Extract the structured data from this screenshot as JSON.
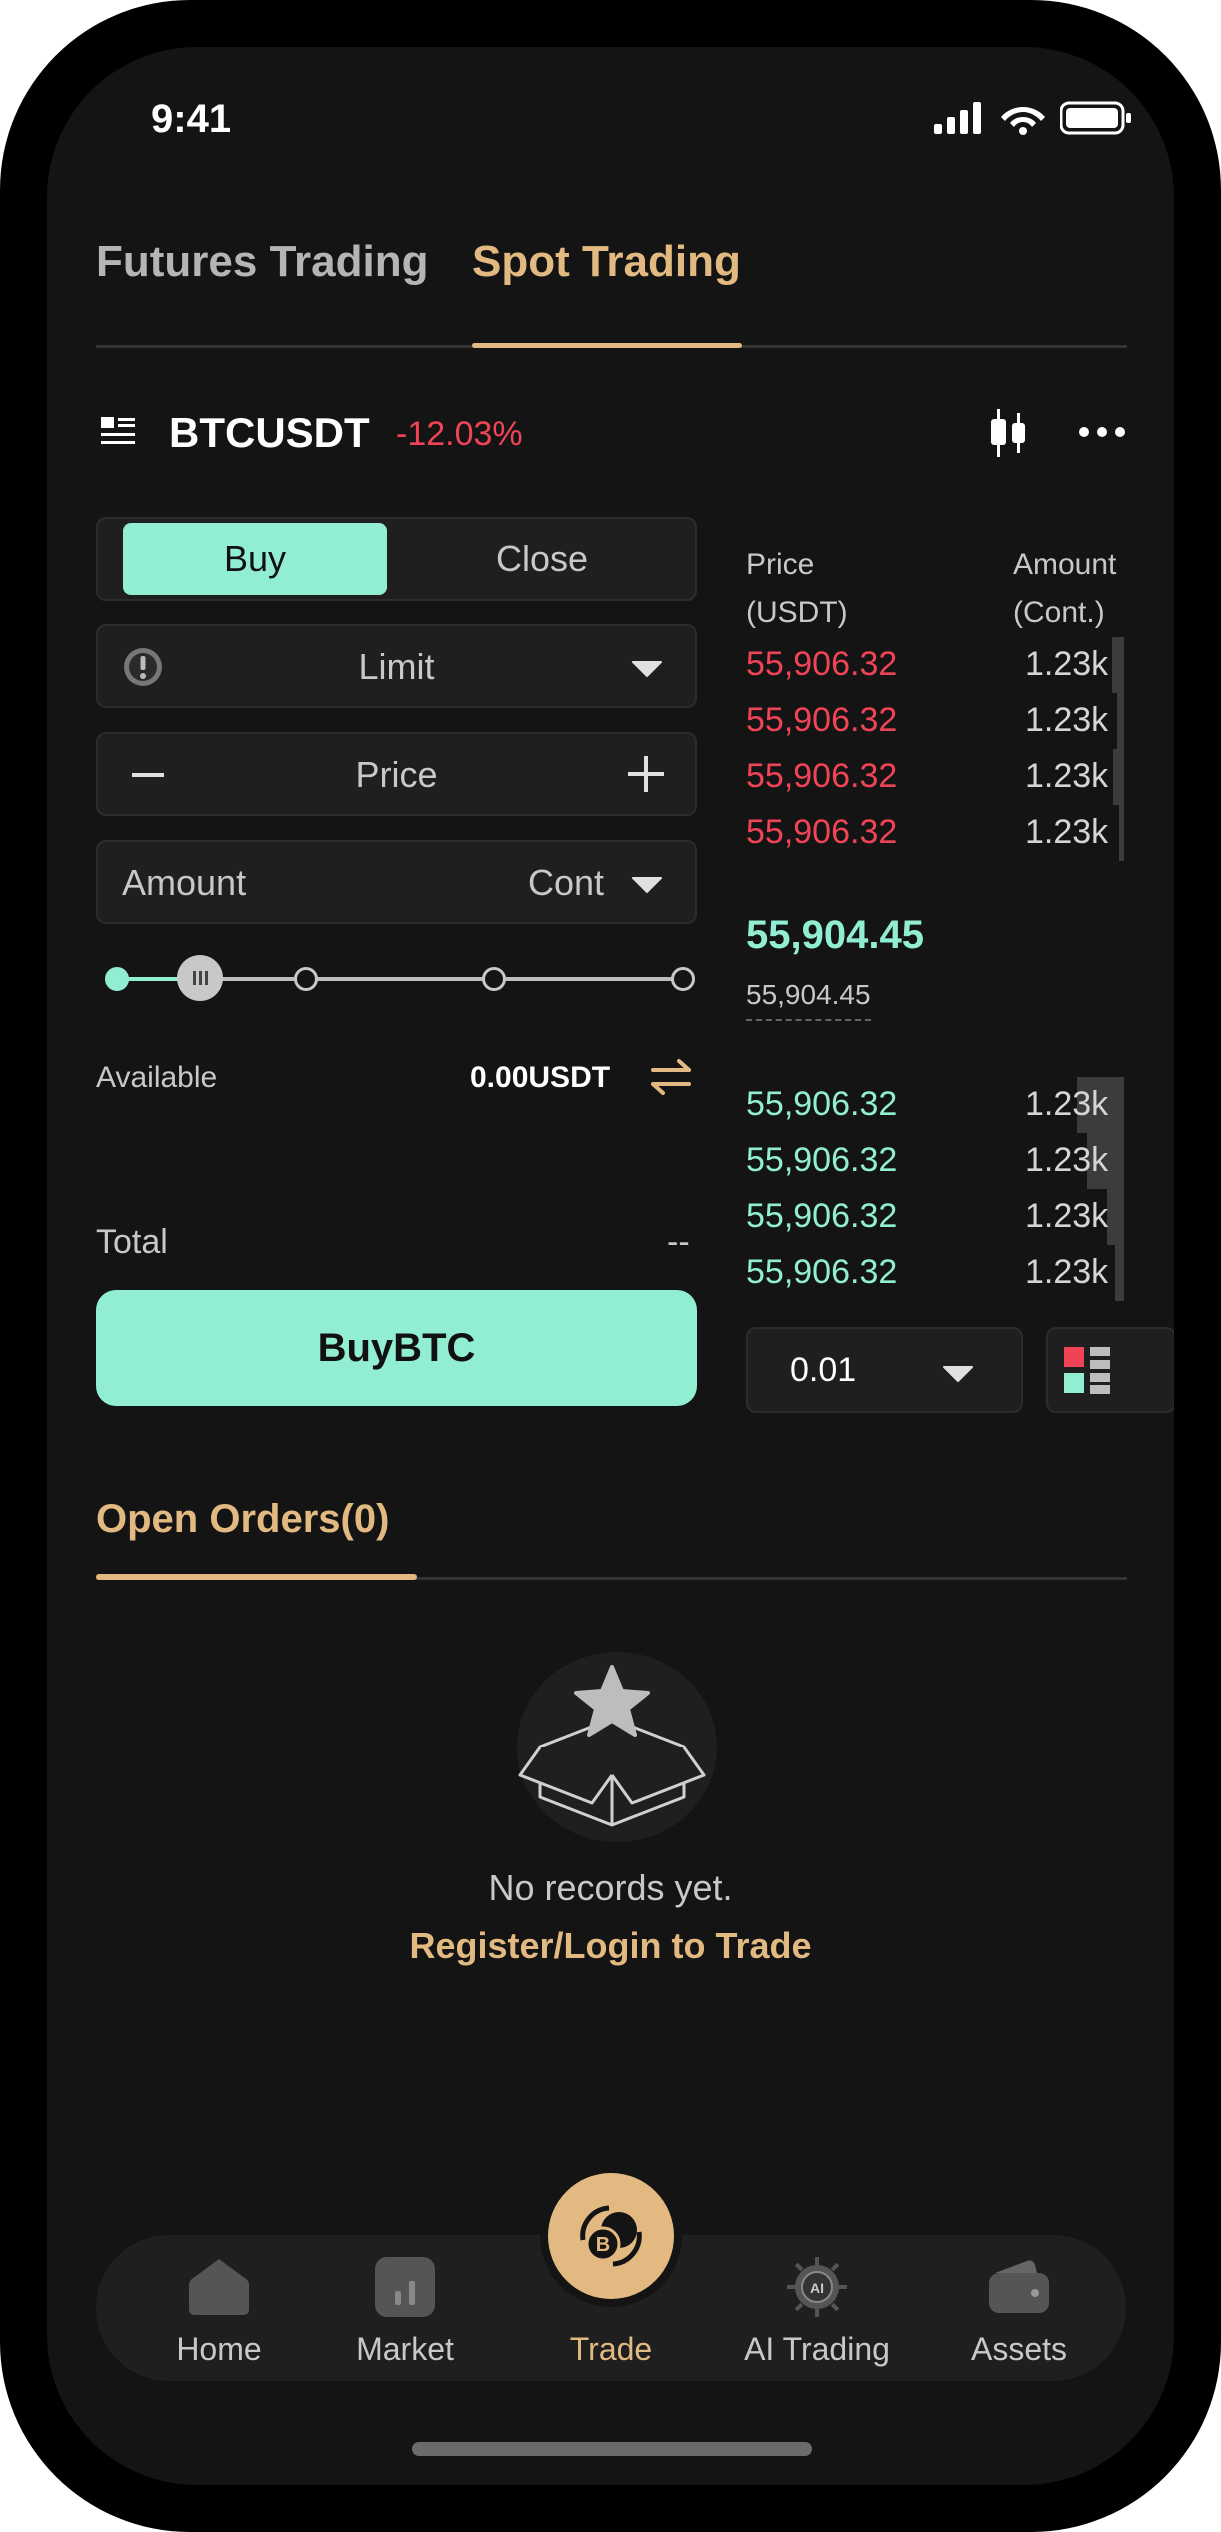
{
  "status_bar": {
    "time": "9:41"
  },
  "tabs": [
    {
      "label": "Futures Trading",
      "active": false
    },
    {
      "label": "Spot Trading",
      "active": true
    }
  ],
  "symbol": {
    "name": "BTCUSDT",
    "change": "-12.03%"
  },
  "order_form": {
    "side_buy": "Buy",
    "side_close": "Close",
    "order_type": "Limit",
    "price_placeholder": "Price",
    "amount_label": "Amount",
    "amount_unit": "Cont",
    "slider_level_fraction": 0.25,
    "available_label": "Available",
    "available_value": "0.00USDT",
    "total_label": "Total",
    "total_value": "--",
    "submit_label": "BuyBTC"
  },
  "orderbook": {
    "price_header": "Price",
    "price_unit": "(USDT)",
    "amount_header": "Amount",
    "amount_unit": "(Cont.)",
    "asks": [
      {
        "price": "55,906.32",
        "amount": "1.23k"
      },
      {
        "price": "55,906.32",
        "amount": "1.23k"
      },
      {
        "price": "55,906.32",
        "amount": "1.23k"
      },
      {
        "price": "55,906.32",
        "amount": "1.23k"
      }
    ],
    "last_price": "55,904.45",
    "mark_price": "55,904.45",
    "bids": [
      {
        "price": "55,906.32",
        "amount": "1.23k"
      },
      {
        "price": "55,906.32",
        "amount": "1.23k"
      },
      {
        "price": "55,906.32",
        "amount": "1.23k"
      },
      {
        "price": "55,906.32",
        "amount": "1.23k"
      }
    ],
    "precision": "0.01"
  },
  "open_orders": {
    "title": "Open Orders(0)",
    "empty_text": "No records yet.",
    "login_link": "Register/Login to Trade"
  },
  "bottom_nav": {
    "items": [
      {
        "label": "Home",
        "icon": "home-icon"
      },
      {
        "label": "Market",
        "icon": "market-icon"
      },
      {
        "label": "Trade",
        "icon": "trade-icon",
        "active": true
      },
      {
        "label": "AI Trading",
        "icon": "ai-chip-icon"
      },
      {
        "label": "Assets",
        "icon": "wallet-icon"
      }
    ]
  },
  "colors": {
    "accent_gold": "#e2b980",
    "buy_green": "#91eed2",
    "sell_red": "#f04456",
    "background": "#141414"
  }
}
